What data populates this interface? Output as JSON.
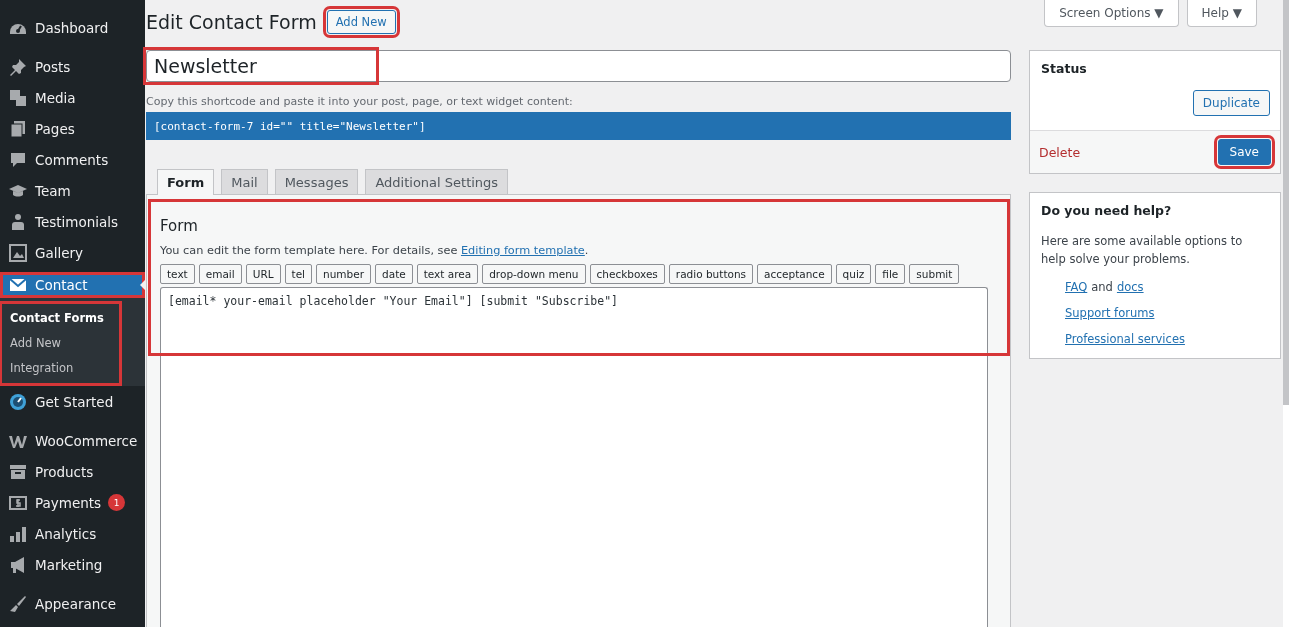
{
  "sidebar": {
    "items": [
      {
        "label": "Dashboard",
        "selected": false
      },
      {
        "label": "Posts",
        "selected": false
      },
      {
        "label": "Media",
        "selected": false
      },
      {
        "label": "Pages",
        "selected": false
      },
      {
        "label": "Comments",
        "selected": false
      },
      {
        "label": "Team",
        "selected": false
      },
      {
        "label": "Testimonials",
        "selected": false
      },
      {
        "label": "Gallery",
        "selected": false
      },
      {
        "label": "Contact",
        "selected": true,
        "highlighted": true,
        "submenu_highlighted": true,
        "children": [
          {
            "label": "Contact Forms",
            "selected": true
          },
          {
            "label": "Add New",
            "selected": false
          },
          {
            "label": "Integration",
            "selected": false
          }
        ]
      },
      {
        "label": "Get Started",
        "selected": false
      },
      {
        "label": "WooCommerce",
        "selected": false
      },
      {
        "label": "Products",
        "selected": false
      },
      {
        "label": "Payments",
        "selected": false,
        "badge": "1"
      },
      {
        "label": "Analytics",
        "selected": false
      },
      {
        "label": "Marketing",
        "selected": false
      },
      {
        "label": "Appearance",
        "selected": false
      }
    ]
  },
  "top_tabs": [
    {
      "label": "Screen Options",
      "caret": "▼"
    },
    {
      "label": "Help",
      "caret": "▼"
    }
  ],
  "page": {
    "title": "Edit Contact Form",
    "add_new": {
      "label": "Add New",
      "highlighted": true
    }
  },
  "form_title": {
    "value": "Newsletter",
    "highlighted": true
  },
  "shortcode": {
    "hint": "Copy this shortcode and paste it into your post, page, or text widget content:",
    "code": "[contact-form-7 id=\"\" title=\"Newsletter\"]"
  },
  "tabs": [
    {
      "label": "Form",
      "selected": true
    },
    {
      "label": "Mail",
      "selected": false
    },
    {
      "label": "Messages",
      "selected": false
    },
    {
      "label": "Additional Settings",
      "selected": false
    }
  ],
  "panel": {
    "highlighted": true,
    "heading": "Form",
    "description": "You can edit the form template here. For details, see ",
    "link": "Editing form template",
    "description_end": ".",
    "tag_buttons": [
      "text",
      "email",
      "URL",
      "tel",
      "number",
      "date",
      "text area",
      "drop-down menu",
      "checkboxes",
      "radio buttons",
      "acceptance",
      "quiz",
      "file",
      "submit"
    ],
    "template": "[email* your-email placeholder \"Your Email\"] [submit \"Subscribe\"]"
  },
  "status": {
    "title": "Status",
    "duplicate": "Duplicate",
    "delete": "Delete",
    "save": {
      "label": "Save",
      "highlighted": true
    }
  },
  "help_box": {
    "title": "Do you need help?",
    "text": "Here are some available options to help solve your problems.",
    "links": [
      [
        {
          "kind": "link",
          "text": "FAQ"
        },
        {
          "kind": "text",
          "text": "and"
        },
        {
          "kind": "link",
          "text": "docs"
        }
      ],
      [
        {
          "kind": "link",
          "text": "Support forums"
        }
      ],
      [
        {
          "kind": "link",
          "text": "Professional services"
        }
      ]
    ]
  }
}
